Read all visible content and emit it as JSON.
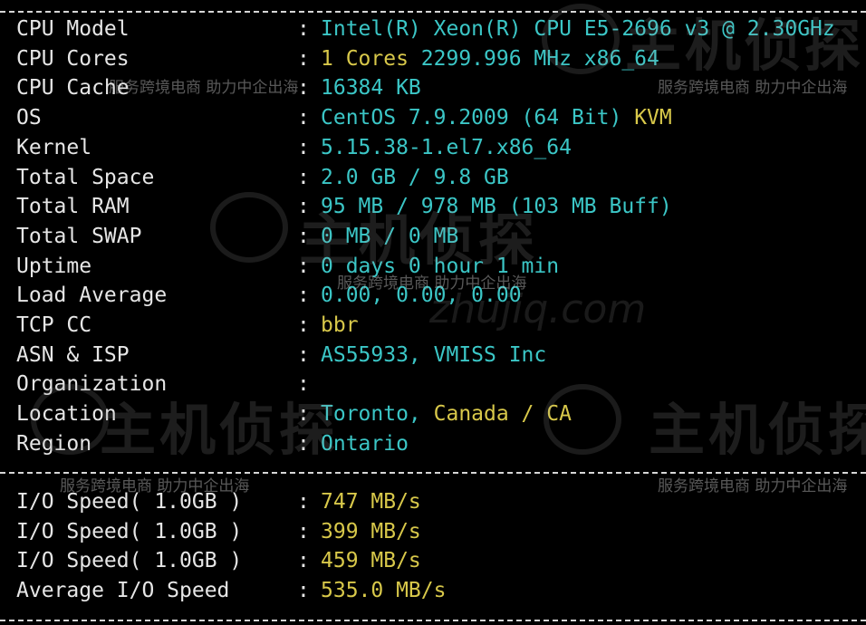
{
  "system_info": [
    {
      "label": "CPU Model",
      "parts": [
        {
          "text": "Intel(R) Xeon(R) CPU E5-2696 v3 @ 2.30GHz",
          "tone": "cyan"
        }
      ]
    },
    {
      "label": "CPU Cores",
      "parts": [
        {
          "text": "1 Cores ",
          "tone": "yellow"
        },
        {
          "text": "2299.996 MHz x86_64",
          "tone": "cyan"
        }
      ]
    },
    {
      "label": "CPU Cache",
      "parts": [
        {
          "text": "16384 KB",
          "tone": "cyan"
        }
      ]
    },
    {
      "label": "OS",
      "parts": [
        {
          "text": "CentOS 7.9.2009 (64 Bit) ",
          "tone": "cyan"
        },
        {
          "text": "KVM",
          "tone": "yellow"
        }
      ]
    },
    {
      "label": "Kernel",
      "parts": [
        {
          "text": "5.15.38-1.el7.x86_64",
          "tone": "cyan"
        }
      ]
    },
    {
      "label": "Total Space",
      "parts": [
        {
          "text": "2.0 GB / 9.8 GB",
          "tone": "cyan"
        }
      ]
    },
    {
      "label": "Total RAM",
      "parts": [
        {
          "text": "95 MB / 978 MB (103 MB Buff)",
          "tone": "cyan"
        }
      ]
    },
    {
      "label": "Total SWAP",
      "parts": [
        {
          "text": "0 MB / 0 MB",
          "tone": "cyan"
        }
      ]
    },
    {
      "label": "Uptime",
      "parts": [
        {
          "text": "0 days 0 hour 1 min",
          "tone": "cyan"
        }
      ]
    },
    {
      "label": "Load Average",
      "parts": [
        {
          "text": "0.00, 0.00, 0.00",
          "tone": "cyan"
        }
      ]
    },
    {
      "label": "TCP CC",
      "parts": [
        {
          "text": "bbr",
          "tone": "yellow"
        }
      ]
    },
    {
      "label": "ASN & ISP",
      "parts": [
        {
          "text": "AS55933, VMISS Inc",
          "tone": "cyan"
        }
      ]
    },
    {
      "label": "Organization",
      "parts": []
    },
    {
      "label": "Location",
      "parts": [
        {
          "text": "Toronto, ",
          "tone": "cyan"
        },
        {
          "text": "Canada / CA",
          "tone": "yellow"
        }
      ]
    },
    {
      "label": "Region",
      "parts": [
        {
          "text": "Ontario",
          "tone": "cyan"
        }
      ]
    }
  ],
  "io_info": [
    {
      "label": "I/O Speed( 1.0GB )",
      "parts": [
        {
          "text": "747 MB/s",
          "tone": "yellow"
        }
      ]
    },
    {
      "label": "I/O Speed( 1.0GB )",
      "parts": [
        {
          "text": "399 MB/s",
          "tone": "yellow"
        }
      ]
    },
    {
      "label": "I/O Speed( 1.0GB )",
      "parts": [
        {
          "text": "459 MB/s",
          "tone": "yellow"
        }
      ]
    },
    {
      "label": "Average I/O Speed",
      "parts": [
        {
          "text": "535.0 MB/s",
          "tone": "yellow"
        }
      ]
    }
  ],
  "separator": ":",
  "watermark": {
    "slogan": "服务跨境电商 助力中企出海",
    "brand": "主机侦探",
    "url": "zhujiq.com"
  },
  "colors": {
    "background": "#000000",
    "label": "#e6e6e6",
    "cyan": "#3bc6c6",
    "yellow": "#d8c84a"
  }
}
